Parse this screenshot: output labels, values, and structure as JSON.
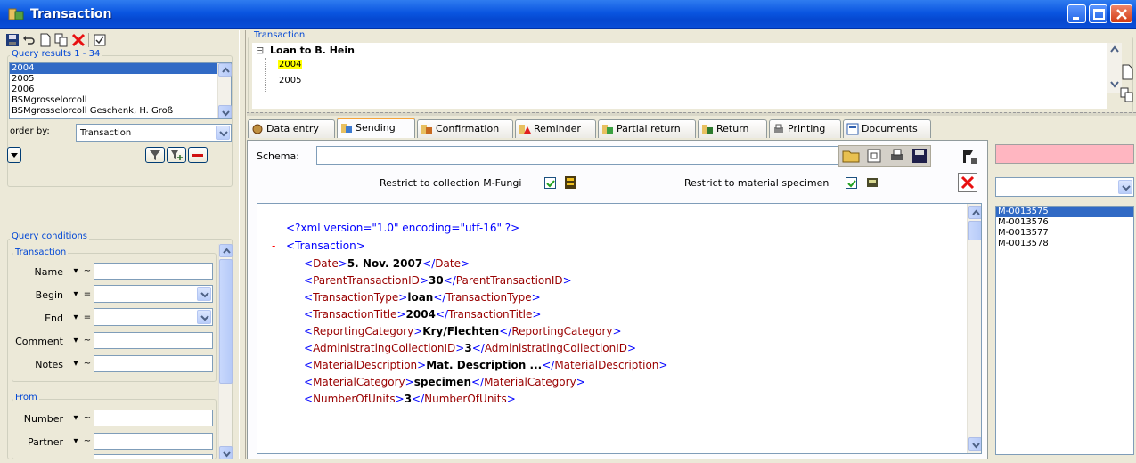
{
  "window": {
    "title": "Transaction"
  },
  "left": {
    "query_results_label": "Query results  1 - 34",
    "results": [
      "2004",
      "2005",
      "2006",
      "BSMgrosselorcoll",
      "BSMgrosselorcoll Geschenk, H. Groß"
    ],
    "order_by_label": "order by:",
    "order_by_value": "Transaction",
    "query_conditions_label": "Query conditions",
    "transaction_group": "Transaction",
    "from_group": "From",
    "fields": {
      "name": "Name",
      "begin": "Begin",
      "end": "End",
      "comment": "Comment",
      "notes": "Notes",
      "number": "Number",
      "partner": "Partner"
    },
    "ops": {
      "tilde": "~",
      "equals": "=",
      "drop": "▾"
    }
  },
  "tree": {
    "group_label": "Transaction",
    "root": "Loan to B. Hein",
    "children": [
      "2004",
      "2005"
    ],
    "minus": "⊟"
  },
  "tabs": [
    "Data entry",
    "Sending",
    "Confirmation",
    "Reminder",
    "Partial return",
    "Return",
    "Printing",
    "Documents"
  ],
  "sending": {
    "schema_label": "Schema:",
    "schema_value": "",
    "restrict_collection_label": "Restrict to collection M-Fungi",
    "restrict_material_label": "Restrict to material specimen",
    "specimens": [
      "M-0013575",
      "M-0013576",
      "M-0013577",
      "M-0013578"
    ]
  },
  "xml": {
    "decl": "<?xml version=\"1.0\" encoding=\"utf-16\" ?>",
    "minus": "-",
    "root_open": "<Transaction>",
    "lines": [
      {
        "tag": "Date",
        "value": "5. Nov. 2007"
      },
      {
        "tag": "ParentTransactionID",
        "value": "30"
      },
      {
        "tag": "TransactionType",
        "value": "loan"
      },
      {
        "tag": "TransactionTitle",
        "value": "2004"
      },
      {
        "tag": "ReportingCategory",
        "value": "Kry/Flechten"
      },
      {
        "tag": "AdministratingCollectionID",
        "value": "3"
      },
      {
        "tag": "MaterialDescription",
        "value": "Mat. Description ..."
      },
      {
        "tag": "MaterialCategory",
        "value": "specimen"
      },
      {
        "tag": "NumberOfUnits",
        "value": "3"
      }
    ]
  },
  "colors": {
    "title_bar": "#0a55e0",
    "selection": "#316ac5",
    "tree_highlight": "#ffff00",
    "group_label": "#0046d5",
    "xml_tag": "#0000ff",
    "xml_name": "#990000",
    "pink_field": "#ffb6c1",
    "active_tab": "#f5a43c"
  }
}
